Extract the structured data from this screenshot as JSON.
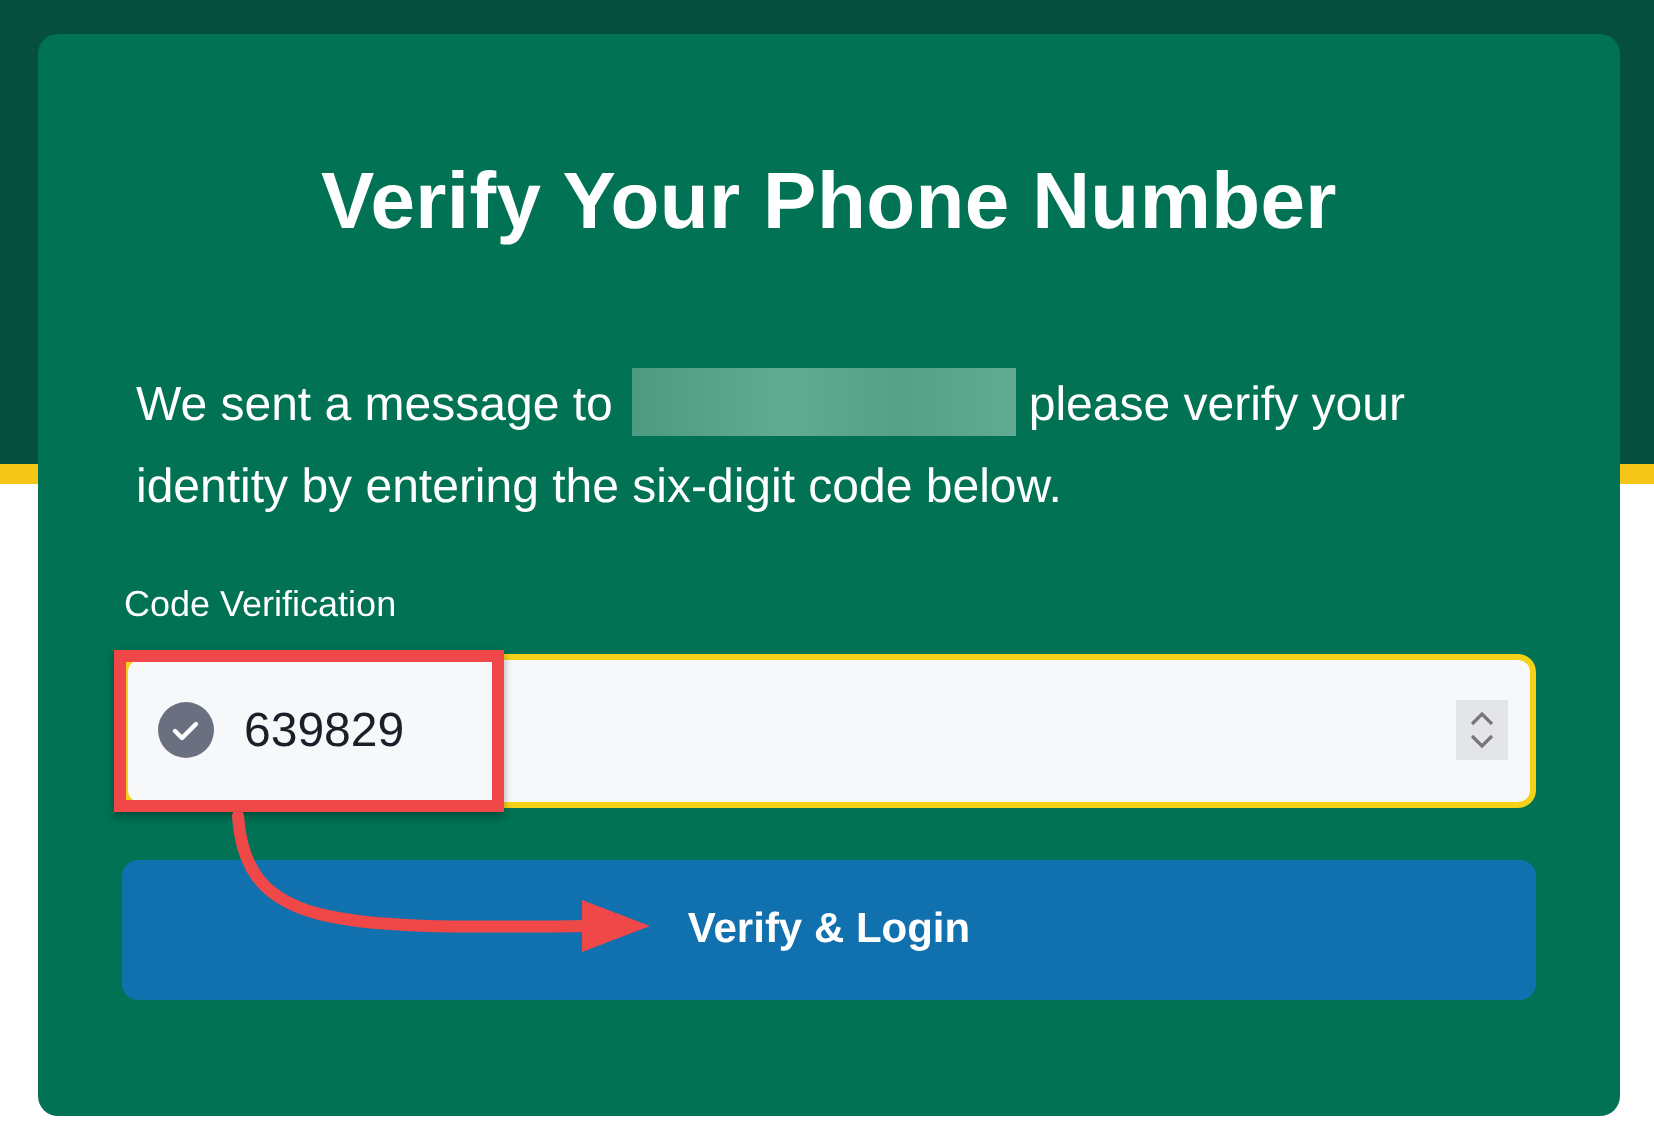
{
  "card": {
    "title": "Verify Your Phone Number",
    "message": {
      "before": "We sent a message to",
      "after": "please verify your identity by entering the six-digit code below."
    },
    "code_field": {
      "label": "Code Verification",
      "value": "639829"
    },
    "submit_button": {
      "label": "Verify & Login"
    }
  }
}
